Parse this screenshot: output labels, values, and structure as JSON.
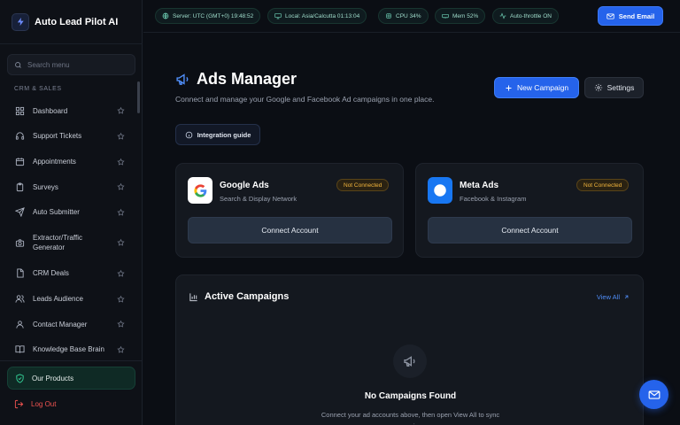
{
  "app": {
    "title": "Auto Lead Pilot AI"
  },
  "sidebar": {
    "search_placeholder": "Search menu",
    "section_label": "CRM & SALES",
    "items": [
      {
        "label": "Dashboard",
        "icon": "dashboard-icon"
      },
      {
        "label": "Support Tickets",
        "icon": "headset-icon"
      },
      {
        "label": "Appointments",
        "icon": "calendar-icon"
      },
      {
        "label": "Surveys",
        "icon": "clipboard-icon"
      },
      {
        "label": "Auto Submitter",
        "icon": "send-icon"
      },
      {
        "label": "Extractor/Traffic Generator",
        "icon": "camera-icon"
      },
      {
        "label": "CRM Deals",
        "icon": "file-icon"
      },
      {
        "label": "Leads Audience",
        "icon": "users-icon"
      },
      {
        "label": "Contact Manager",
        "icon": "user-group-icon"
      },
      {
        "label": "Knowledge Base Brain",
        "icon": "book-icon"
      }
    ],
    "our_products": "Our Products",
    "logout": "Log Out"
  },
  "topbar": {
    "chips": [
      {
        "label": "Server: UTC (GMT+0) 19:48:52",
        "icon": "globe-icon"
      },
      {
        "label": "Local: Asia/Calcutta 01:13:04",
        "icon": "monitor-icon"
      },
      {
        "label": "CPU 34%",
        "icon": "cpu-icon"
      },
      {
        "label": "Mem 52%",
        "icon": "memory-icon"
      },
      {
        "label": "Auto-throttle ON",
        "icon": "activity-icon"
      }
    ],
    "send_email": "Send Email"
  },
  "main": {
    "title": "Ads Manager",
    "subtitle": "Connect and manage your Google and Facebook Ad campaigns in one place.",
    "new_campaign": "New Campaign",
    "settings": "Settings",
    "integration_guide": "Integration guide",
    "cards": [
      {
        "name": "Google Ads",
        "desc": "Search & Display Network",
        "status": "Not Connected",
        "action": "Connect Account"
      },
      {
        "name": "Meta Ads",
        "desc": "Facebook & Instagram",
        "status": "Not Connected",
        "action": "Connect Account"
      }
    ],
    "campaigns": {
      "title": "Active Campaigns",
      "view_all": "View All",
      "empty_title": "No Campaigns Found",
      "empty_desc": "Connect your ad accounts above, then open View All to sync campaigns."
    }
  },
  "colors": {
    "accent": "#2563eb",
    "background": "#0b0e14",
    "card": "#14181f",
    "warning": "#f4b73d",
    "danger": "#ef5350",
    "success": "#34d399"
  }
}
